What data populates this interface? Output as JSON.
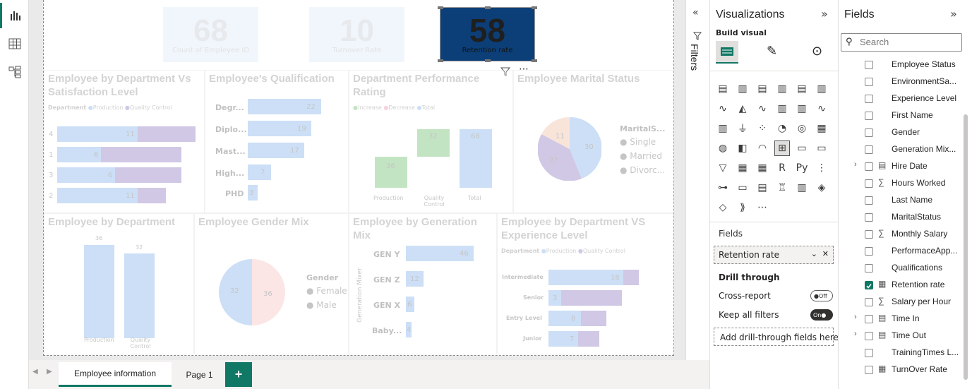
{
  "page": {
    "cards": [
      {
        "value": "68",
        "label": "Count of Employee ID"
      },
      {
        "value": "10",
        "label": "Turnover Rate"
      }
    ],
    "selected_card": {
      "value": "58",
      "label": "Retention rate"
    }
  },
  "visuals": {
    "dept_satisfaction": {
      "title": "Employee by Department Vs Satisfaction Level",
      "legend_title": "Department",
      "legend": [
        "Production",
        "Quality Control"
      ],
      "rows": [
        {
          "label": "4",
          "a": "11",
          "b": "5"
        },
        {
          "label": "1",
          "a": "6",
          "b": "11"
        },
        {
          "label": "3",
          "a": "6",
          "b": "9"
        },
        {
          "label": "2",
          "a": "11",
          "b": "3"
        }
      ]
    },
    "qualification": {
      "title": "Employee's Qualification",
      "rows": [
        {
          "label": "Degr...",
          "value": "22"
        },
        {
          "label": "Diplo...",
          "value": "19"
        },
        {
          "label": "Mast...",
          "value": "17"
        },
        {
          "label": "High...",
          "value": "7"
        },
        {
          "label": "PHD",
          "value": "3"
        }
      ]
    },
    "dept_perf": {
      "title": "Department Performance Rating",
      "legend": [
        "Increase",
        "Decrease",
        "Total"
      ],
      "x": [
        "Production",
        "Quality Control",
        "Total"
      ],
      "values": [
        "36",
        "32",
        "68"
      ]
    },
    "marital": {
      "title": "Employee Marital Status",
      "legend_title": "MaritalS...",
      "legend": [
        "Single",
        "Married",
        "Divorc..."
      ],
      "values": [
        "30",
        "27",
        "11"
      ]
    },
    "by_dept": {
      "title": "Employee by Department",
      "x": [
        "Production",
        "Quality Control"
      ],
      "values": [
        "36",
        "32"
      ]
    },
    "gender": {
      "title": "Employee Gender Mix",
      "legend_title": "Gender",
      "legend": [
        "Female",
        "Male"
      ],
      "values": [
        "32",
        "36"
      ]
    },
    "generation": {
      "title": "Employee by Generation Mix",
      "yaxis": "Generation Mixer",
      "rows": [
        {
          "label": "GEN Y",
          "value": "46"
        },
        {
          "label": "GEN Z",
          "value": "12"
        },
        {
          "label": "GEN X",
          "value": "6"
        },
        {
          "label": "Baby...",
          "value": "4"
        }
      ]
    },
    "dept_exp": {
      "title": "Employee by Department VS Experience Level",
      "legend_title": "Department",
      "legend": [
        "Production",
        "Quality Control"
      ],
      "rows": [
        {
          "label": "Intermediate",
          "a": "18",
          "b": "4"
        },
        {
          "label": "Senior",
          "a": "3",
          "b": "15"
        },
        {
          "label": "Entry Level",
          "a": "8",
          "b": "6"
        },
        {
          "label": "Junior",
          "a": "7",
          "b": "5"
        }
      ]
    }
  },
  "filters": {
    "label": "Filters"
  },
  "viz": {
    "title": "Visualizations",
    "build": "Build visual",
    "fields_label": "Fields",
    "field_well": "Retention rate",
    "drill": "Drill through",
    "cross": "Cross-report",
    "cross_state": "Off",
    "keep": "Keep all filters",
    "keep_state": "On",
    "add_drill": "Add drill-through fields here"
  },
  "fields": {
    "title": "Fields",
    "search_placeholder": "Search",
    "items": [
      {
        "name": "Employee Status",
        "sym": "",
        "exp": false,
        "checked": false
      },
      {
        "name": "EnvironmentSa...",
        "sym": "",
        "exp": false,
        "checked": false
      },
      {
        "name": "Experience Level",
        "sym": "",
        "exp": false,
        "checked": false
      },
      {
        "name": "First Name",
        "sym": "",
        "exp": false,
        "checked": false
      },
      {
        "name": "Gender",
        "sym": "",
        "exp": false,
        "checked": false
      },
      {
        "name": "Generation Mix...",
        "sym": "",
        "exp": false,
        "checked": false
      },
      {
        "name": "Hire Date",
        "sym": "table",
        "exp": true,
        "checked": false
      },
      {
        "name": "Hours Worked",
        "sym": "sigma",
        "exp": false,
        "checked": false
      },
      {
        "name": "Last Name",
        "sym": "",
        "exp": false,
        "checked": false
      },
      {
        "name": "MaritalStatus",
        "sym": "",
        "exp": false,
        "checked": false
      },
      {
        "name": "Monthly Salary",
        "sym": "sigma",
        "exp": false,
        "checked": false
      },
      {
        "name": "PerformaceApp...",
        "sym": "",
        "exp": false,
        "checked": false
      },
      {
        "name": "Qualifications",
        "sym": "",
        "exp": false,
        "checked": false
      },
      {
        "name": "Retention rate",
        "sym": "calc",
        "exp": false,
        "checked": true
      },
      {
        "name": "Salary per Hour",
        "sym": "sigma",
        "exp": false,
        "checked": false
      },
      {
        "name": "Time In",
        "sym": "table",
        "exp": true,
        "checked": false
      },
      {
        "name": "Time Out",
        "sym": "table",
        "exp": true,
        "checked": false
      },
      {
        "name": "TrainingTimes L...",
        "sym": "",
        "exp": false,
        "checked": false
      },
      {
        "name": "TurnOver Rate",
        "sym": "calc",
        "exp": false,
        "checked": false
      }
    ]
  },
  "tabs": [
    {
      "label": "Employee information",
      "active": true
    },
    {
      "label": "Page 1",
      "active": false
    }
  ],
  "add_tab": "+"
}
